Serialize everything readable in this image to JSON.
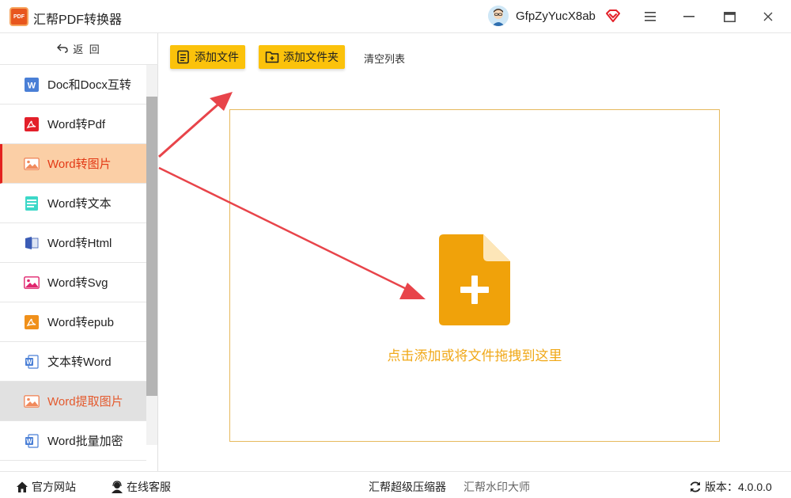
{
  "app": {
    "title": "汇帮PDF转换器",
    "logo_text": "PDF",
    "username": "GfpZyYucX8ab"
  },
  "sidebar": {
    "back_label": "返  回",
    "items": [
      {
        "label": "Doc和Docx互转",
        "icon": "word-icon",
        "state": "normal"
      },
      {
        "label": "Word转Pdf",
        "icon": "pdf-icon",
        "state": "normal"
      },
      {
        "label": "Word转图片",
        "icon": "image-icon",
        "state": "active"
      },
      {
        "label": "Word转文本",
        "icon": "text-doc-icon",
        "state": "normal"
      },
      {
        "label": "Word转Html",
        "icon": "html-icon",
        "state": "normal"
      },
      {
        "label": "Word转Svg",
        "icon": "svg-image-icon",
        "state": "normal"
      },
      {
        "label": "Word转epub",
        "icon": "epub-icon",
        "state": "normal"
      },
      {
        "label": "文本转Word",
        "icon": "word-outline-icon",
        "state": "normal"
      },
      {
        "label": "Word提取图片",
        "icon": "image-icon",
        "state": "hover"
      },
      {
        "label": "Word批量加密",
        "icon": "word-outline-icon",
        "state": "normal"
      }
    ]
  },
  "toolbar": {
    "add_file": "添加文件",
    "add_folder": "添加文件夹",
    "clear_list": "清空列表"
  },
  "dropzone": {
    "hint": "点击添加或将文件拖拽到这里"
  },
  "footer": {
    "website": "官方网站",
    "support": "在线客服",
    "compressor": "汇帮超级压缩器",
    "watermark": "汇帮水印大师",
    "version_label": "版本：",
    "version": "4.0.0.0"
  },
  "colors": {
    "accent": "#fbc20b",
    "active_bg": "#fbcfa6",
    "active_text": "#e33a16",
    "drop_hint": "#f0a818",
    "arrow": "#e8444a"
  }
}
